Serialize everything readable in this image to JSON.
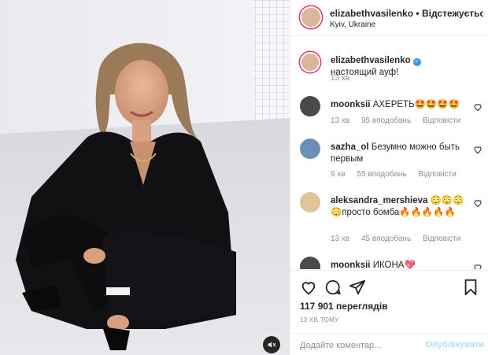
{
  "header": {
    "username": "elizabethvasilenko",
    "separator": "•",
    "follow_label": "Відстежується",
    "location": "Kyiv, Ukraine"
  },
  "caption": {
    "username": "elizabethvasilenko",
    "text": "настоящий ауф!",
    "time": "13 хв"
  },
  "comments": [
    {
      "username": "moonksii",
      "text": "АХЕРЕТЬ🤩🤩🤩🤩",
      "time": "13 хв",
      "likes": "95 вподобань",
      "reply": "Відповісти"
    },
    {
      "username": "sazha_ol",
      "text": "Безумно можно быть первым",
      "time": "9 хв",
      "likes": "55 вподобань",
      "reply": "Відповісти"
    },
    {
      "username": "aleksandra_mershieva",
      "text": "😳😳😳😳просто бомба🔥🔥🔥🔥🔥",
      "time": "13 хв",
      "likes": "45 вподобань",
      "reply": "Відповісти"
    },
    {
      "username": "moonksii",
      "text": "ИКОНА💖",
      "time": "",
      "likes": "",
      "reply": ""
    }
  ],
  "stats": {
    "views": "117 901 переглядів",
    "posted_ago": "13 ХВ ТОМУ"
  },
  "comment_box": {
    "placeholder": "Додайте коментар...",
    "publish_label": "Опублікувати"
  },
  "colors": {
    "accent": "#3897f0",
    "publish_disabled": "#b2dffc",
    "muted": "#8e8e8e",
    "story_ring": "#e1306c"
  },
  "icons": [
    "heart-icon",
    "comment-icon",
    "share-icon",
    "bookmark-icon",
    "mute-icon",
    "verified-icon"
  ]
}
